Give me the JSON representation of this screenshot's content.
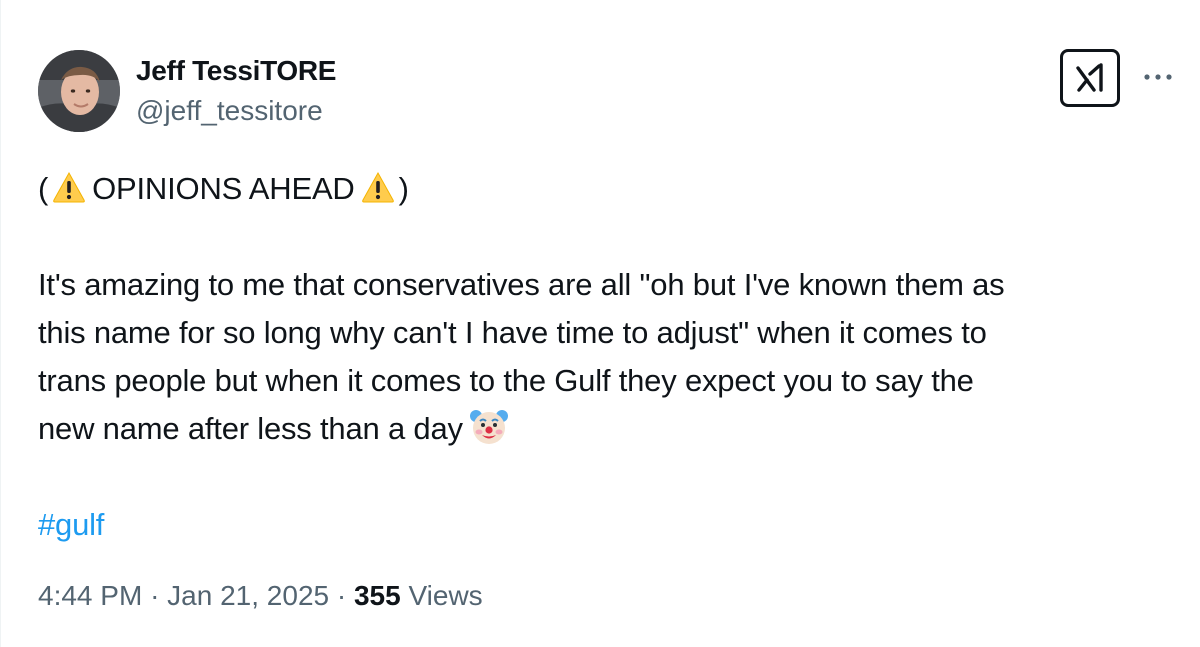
{
  "author": {
    "display_name": "Jeff TessiTORE",
    "handle": "@jeff_tessitore"
  },
  "header_icons": {
    "grok": "grok-icon",
    "more": "more-horizontal-icon"
  },
  "tweet": {
    "warning_line": {
      "open_paren": "(",
      "emoji_before": "warning-emoji",
      "text": "OPINIONS AHEAD",
      "emoji_after": "warning-emoji",
      "close_paren": ")"
    },
    "body_lines": [
      "It's amazing to me that conservatives are all \"oh but I've known them as",
      "this name for so long why can't I have time to adjust\" when it comes to",
      "trans people but when it comes to the Gulf they expect you to say the",
      "new name after less than a day"
    ],
    "body_end_emoji": "clown-face-emoji",
    "hashtag": "#gulf"
  },
  "meta": {
    "time": "4:44 PM",
    "separator": "·",
    "date": "Jan 21, 2025",
    "views_count": "355",
    "views_label": "Views"
  },
  "colors": {
    "text": "#0f1419",
    "secondary": "#536471",
    "link": "#1d9bf0"
  }
}
